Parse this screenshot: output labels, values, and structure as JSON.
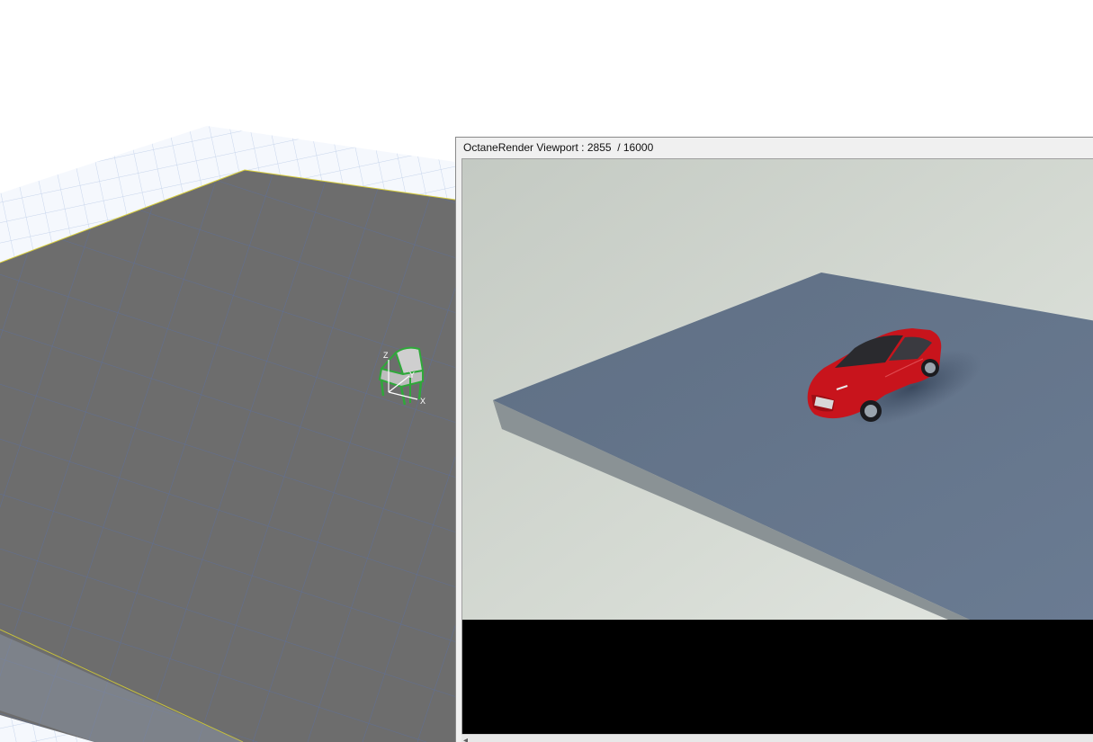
{
  "render_viewport": {
    "title": "OctaneRender Viewport : 2855  / 16000"
  },
  "scene": {
    "axis_labels": {
      "z": "Z",
      "y": "Y",
      "x": "X"
    }
  },
  "icons": {
    "scroll_left": "◂"
  },
  "colors": {
    "grid_light": "#dbe4f2",
    "floor_gray": "#6e6e6e",
    "floor_edge": "#c8c23a",
    "chair_outline": "#2fa83a",
    "render_background": "#d4d9d3",
    "render_platform_top": "#63758b",
    "render_platform_side": "#8e9597",
    "car_red": "#c8141c"
  }
}
